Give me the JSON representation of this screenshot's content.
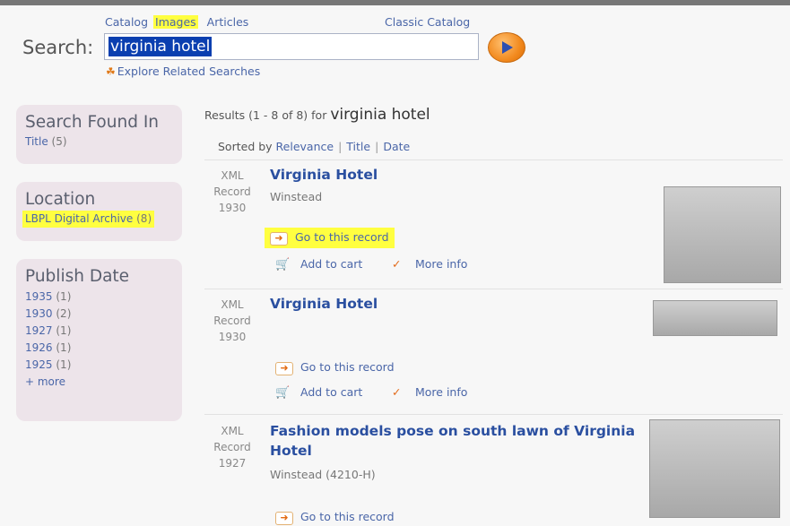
{
  "header": {
    "tabs": [
      {
        "label": "Catalog"
      },
      {
        "label": "Images",
        "highlighted": true
      },
      {
        "label": "Articles"
      }
    ],
    "classic_link": "Classic Catalog",
    "search_label": "Search:",
    "search_value": "virginia hotel",
    "explore_label": "Explore Related Searches"
  },
  "sidebar": {
    "found_in": {
      "title": "Search Found In",
      "items": [
        {
          "label": "Title",
          "count": "(5)"
        }
      ]
    },
    "location": {
      "title": "Location",
      "items": [
        {
          "label": "LBPL Digital Archive",
          "count": "(8)"
        }
      ]
    },
    "publish_date": {
      "title": "Publish Date",
      "items": [
        {
          "label": "1935",
          "count": "(1)"
        },
        {
          "label": "1930",
          "count": "(2)"
        },
        {
          "label": "1927",
          "count": "(1)"
        },
        {
          "label": "1926",
          "count": "(1)"
        },
        {
          "label": "1925",
          "count": "(1)"
        }
      ],
      "more": "+ more"
    }
  },
  "results": {
    "summary": "Results (1 - 8 of 8) for",
    "query": "virginia hotel",
    "sort_label": "Sorted by",
    "sort_options": [
      "Relevance",
      "Title",
      "Date"
    ],
    "items": [
      {
        "format": "XML",
        "type": "Record",
        "year": "1930",
        "title": "Virginia Hotel",
        "author": "Winstead",
        "go_label": "Go to this record",
        "cart_label": "Add to cart",
        "info_label": "More info"
      },
      {
        "format": "XML",
        "type": "Record",
        "year": "1930",
        "title": "Virginia Hotel",
        "author": "",
        "go_label": "Go to this record",
        "cart_label": "Add to cart",
        "info_label": "More info"
      },
      {
        "format": "XML",
        "type": "Record",
        "year": "1927",
        "title_line1": "Fashion models pose on south lawn of Virginia",
        "title_line2": "Hotel",
        "author": "Winstead (4210-H)",
        "go_label": "Go to this record"
      }
    ]
  },
  "colors": {
    "link": "#4a66a8",
    "title": "#2a4fa0",
    "highlight": "#ffff40",
    "accent": "#f28a1e",
    "panel": "#ede4ea"
  }
}
